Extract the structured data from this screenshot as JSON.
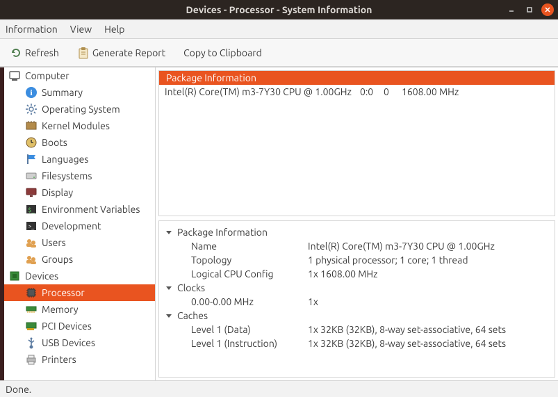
{
  "window": {
    "title": "Devices - Processor - System Information"
  },
  "menubar": {
    "information": "Information",
    "view": "View",
    "help": "Help"
  },
  "toolbar": {
    "refresh": "Refresh",
    "generate_report": "Generate Report",
    "copy": "Copy to Clipboard"
  },
  "sidebar": {
    "items": [
      {
        "label": "Computer",
        "depth": 0,
        "icon": "computer"
      },
      {
        "label": "Summary",
        "depth": 1,
        "icon": "info"
      },
      {
        "label": "Operating System",
        "depth": 1,
        "icon": "gear"
      },
      {
        "label": "Kernel Modules",
        "depth": 1,
        "icon": "module"
      },
      {
        "label": "Boots",
        "depth": 1,
        "icon": "clock"
      },
      {
        "label": "Languages",
        "depth": 1,
        "icon": "flag"
      },
      {
        "label": "Filesystems",
        "depth": 1,
        "icon": "drive"
      },
      {
        "label": "Display",
        "depth": 1,
        "icon": "display"
      },
      {
        "label": "Environment Variables",
        "depth": 1,
        "icon": "env"
      },
      {
        "label": "Development",
        "depth": 1,
        "icon": "terminal"
      },
      {
        "label": "Users",
        "depth": 1,
        "icon": "users"
      },
      {
        "label": "Groups",
        "depth": 1,
        "icon": "users"
      },
      {
        "label": "Devices",
        "depth": 0,
        "icon": "chip"
      },
      {
        "label": "Processor",
        "depth": 1,
        "icon": "cpu",
        "selected": true
      },
      {
        "label": "Memory",
        "depth": 1,
        "icon": "memory"
      },
      {
        "label": "PCI Devices",
        "depth": 1,
        "icon": "pci"
      },
      {
        "label": "USB Devices",
        "depth": 1,
        "icon": "usb"
      },
      {
        "label": "Printers",
        "depth": 1,
        "icon": "printer"
      }
    ]
  },
  "top_pane": {
    "header": "Package Information",
    "row": {
      "name": "Intel(R) Core(TM) m3-7Y30 CPU @ 1.00GHz",
      "col2": "0:0",
      "col3": "0",
      "freq": "1608.00 MHz"
    }
  },
  "details": {
    "groups": [
      {
        "title": "Package Information",
        "rows": [
          {
            "k": "Name",
            "v": "Intel(R) Core(TM) m3-7Y30 CPU @ 1.00GHz"
          },
          {
            "k": "Topology",
            "v": "1 physical processor; 1 core; 1 thread"
          },
          {
            "k": "Logical CPU Config",
            "v": "1x 1608.00 MHz"
          }
        ]
      },
      {
        "title": "Clocks",
        "rows": [
          {
            "k": "0.00-0.00 MHz",
            "v": "1x"
          }
        ]
      },
      {
        "title": "Caches",
        "rows": [
          {
            "k": "Level 1 (Data)",
            "v": "1x 32KB (32KB), 8-way set-associative, 64 sets"
          },
          {
            "k": "Level 1 (Instruction)",
            "v": "1x 32KB (32KB), 8-way set-associative, 64 sets"
          }
        ]
      }
    ]
  },
  "statusbar": {
    "text": "Done."
  },
  "icons": {
    "computer": "<rect x='2' y='3' width='14' height='10' rx='1' fill='none' stroke='#5a5a5a' stroke-width='1.4'/><rect x='5' y='14' width='8' height='2' fill='#5a5a5a'/>",
    "info": "<circle cx='9' cy='9' r='8' fill='#3b8de0'/><text x='9' y='13' text-anchor='middle' fill='#fff' font-size='12' font-family='serif' font-weight='bold'>i</text>",
    "gear": "<circle cx='9' cy='9' r='3' fill='none' stroke='#5a7aa0' stroke-width='1.4'/><g stroke='#5a7aa0' stroke-width='1.6'><line x1='9' y1='1' x2='9' y2='4'/><line x1='9' y1='14' x2='9' y2='17'/><line x1='1' y1='9' x2='4' y2='9'/><line x1='14' y1='9' x2='17' y2='9'/><line x1='3' y1='3' x2='5' y2='5'/><line x1='13' y1='13' x2='15' y2='15'/><line x1='3' y1='15' x2='5' y2='13'/><line x1='13' y1='5' x2='15' y2='3'/></g>",
    "module": "<rect x='2' y='4' width='14' height='10' fill='#b38b4a' stroke='#7a5a2a'/><line x1='5' y1='2' x2='5' y2='4' stroke='#7a5a2a'/><line x1='9' y1='2' x2='9' y2='4' stroke='#7a5a2a'/><line x1='13' y1='2' x2='13' y2='4' stroke='#7a5a2a'/>",
    "clock": "<circle cx='9' cy='9' r='7' fill='#e0c068' stroke='#7a5a2a'/><line x1='9' y1='9' x2='9' y2='5' stroke='#333' stroke-width='1.4'/><line x1='9' y1='9' x2='12' y2='9' stroke='#333' stroke-width='1.4'/>",
    "flag": "<rect x='3' y='2' width='2' height='14' fill='#5a7aa0'/><path d='M5 3 L15 3 L13 6 L15 9 L5 9 Z' fill='#3b8de0'/>",
    "drive": "<rect x='2' y='5' width='14' height='8' rx='1' fill='#d0d0d0' stroke='#888'/><circle cx='13' cy='11' r='1' fill='#5a5'/>",
    "display": "<rect x='2' y='3' width='14' height='9' rx='1' fill='#8b3a3a' stroke='#6a2a2a'/><rect x='7' y='13' width='4' height='2' fill='#6a2a2a'/>",
    "env": "<rect x='2' y='3' width='14' height='12' fill='#333'/><text x='9' y='13' text-anchor='middle' fill='#6c6' font-size='9'>$_</text>",
    "terminal": "<rect x='2' y='3' width='14' height='12' fill='#333'/><text x='9' y='12' text-anchor='middle' fill='#fff' font-size='8'>&gt;_</text>",
    "users": "<circle cx='6' cy='7' r='3' fill='#e0a050'/><circle cx='12' cy='9' r='3' fill='#e0a050'/><rect x='2' y='10' width='8' height='5' rx='2' fill='#e0a050'/><rect x='8' y='12' width='8' height='4' rx='2' fill='#e0a050'/>",
    "chip": "<rect x='3' y='3' width='12' height='12' fill='#3a8a3a' stroke='#276a27'/><rect x='6' y='6' width='6' height='6' fill='#276a27'/>",
    "cpu": "<rect x='4' y='4' width='10' height='10' fill='#555' stroke='#333'/><g stroke='#333'><line x1='2' y1='6' x2='4' y2='6'/><line x1='2' y1='9' x2='4' y2='9'/><line x1='2' y1='12' x2='4' y2='12'/><line x1='14' y1='6' x2='16' y2='6'/><line x1='14' y1='9' x2='16' y2='9'/><line x1='14' y1='12' x2='16' y2='12'/><line x1='6' y1='2' x2='6' y2='4'/><line x1='9' y1='2' x2='9' y2='4'/><line x1='12' y1='2' x2='12' y2='4'/><line x1='6' y1='14' x2='6' y2='16'/><line x1='9' y1='14' x2='9' y2='16'/><line x1='12' y1='14' x2='12' y2='16'/></g>",
    "memory": "<rect x='2' y='5' width='14' height='6' fill='#3a8a3a' stroke='#276a27'/><line x1='4' y1='11' x2='4' y2='14' stroke='#d4a020'/><line x1='7' y1='11' x2='7' y2='14' stroke='#d4a020'/><line x1='10' y1='11' x2='10' y2='14' stroke='#d4a020'/><line x1='13' y1='11' x2='13' y2='14' stroke='#d4a020'/>",
    "pci": "<rect x='2' y='4' width='14' height='8' fill='#3a8a3a' stroke='#276a27'/><rect x='3' y='12' width='10' height='3' fill='#d4a020'/>",
    "usb": "<circle cx='9' cy='15' r='2.5' fill='#5a7aa0'/><line x1='9' y1='3' x2='9' y2='13' stroke='#5a7aa0' stroke-width='1.6'/><line x1='9' y1='8' x2='5' y2='5' stroke='#5a7aa0' stroke-width='1.6'/><line x1='9' y1='9' x2='13' y2='6' stroke='#5a7aa0' stroke-width='1.6'/><circle cx='9' cy='3' r='1.5' fill='#5a7aa0'/>",
    "printer": "<rect x='3' y='7' width='12' height='6' fill='#bbb' stroke='#888'/><rect x='5' y='3' width='8' height='4' fill='#eee' stroke='#888'/><rect x='5' y='12' width='8' height='4' fill='#eee' stroke='#888'/>",
    "refresh": "<path d='M4 9a5 5 0 1 1 1.5 3.5' fill='none' stroke='#4a7a4a' stroke-width='1.8'/><path d='M4 5 L4 9 L8 9 Z' fill='#4a7a4a'/>",
    "report": "<rect x='3' y='3' width='12' height='14' rx='1' fill='#f4e8c8' stroke='#b09050'/><rect x='6' y='1' width='6' height='4' rx='1' fill='#b09050'/><line x1='6' y1='8' x2='12' y2='8' stroke='#b09050'/><line x1='6' y1='11' x2='12' y2='11' stroke='#b09050'/>",
    "disclosure_down": "<path d='M2 4 L10 4 L6 9 Z' fill='#555'/>"
  }
}
